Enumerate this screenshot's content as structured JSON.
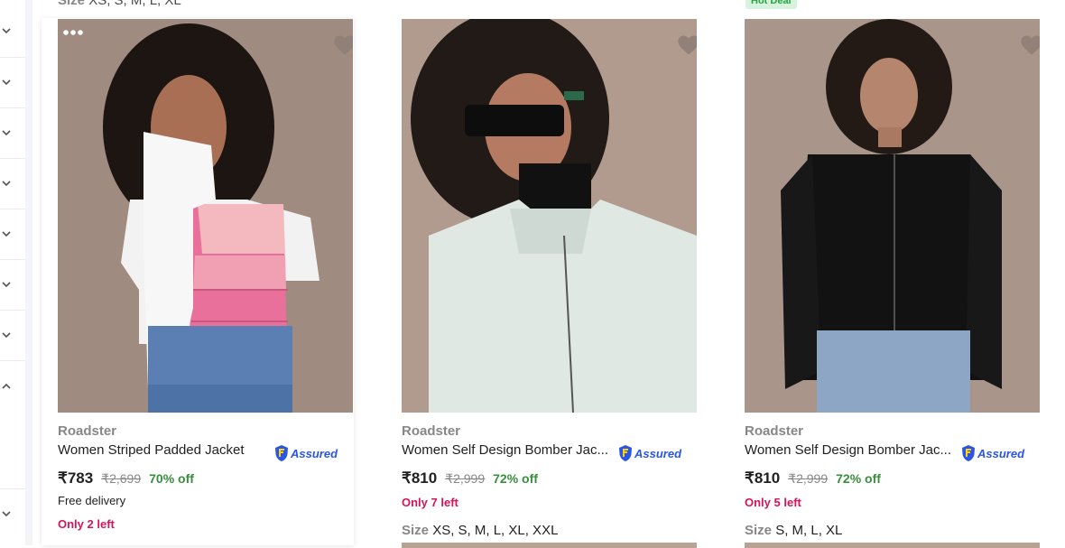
{
  "filters": {
    "chevrons": [
      "down",
      "down",
      "down",
      "down",
      "down",
      "down",
      "down",
      "up",
      "down"
    ]
  },
  "top": {
    "size_label": "Size",
    "size_values": "XS, S, M, L, XL",
    "hot_deal": "Hot Deal"
  },
  "products": [
    {
      "brand": "Roadster",
      "title": "Women Striped Padded Jacket",
      "assured": "Assured",
      "price": "₹783",
      "mrp": "₹2,699",
      "discount": "70% off",
      "delivery": "Free delivery",
      "stock": "Only 2 left",
      "size_label": "",
      "sizes": ""
    },
    {
      "brand": "Roadster",
      "title": "Women Self Design Bomber Jac...",
      "assured": "Assured",
      "price": "₹810",
      "mrp": "₹2,999",
      "discount": "72% off",
      "delivery": "",
      "stock": "Only 7 left",
      "size_label": "Size",
      "sizes": "XS, S, M, L, XL, XXL"
    },
    {
      "brand": "Roadster",
      "title": "Women Self Design Bomber Jac...",
      "assured": "Assured",
      "price": "₹810",
      "mrp": "₹2,999",
      "discount": "72% off",
      "delivery": "",
      "stock": "Only 5 left",
      "size_label": "Size",
      "sizes": "S, M, L, XL"
    }
  ],
  "colors": {
    "accent_green": "#388e3c",
    "stock_red": "#d4145a",
    "assured_blue": "#2a55e5",
    "muted": "#878787"
  },
  "icons": [
    "chevron-down-icon",
    "chevron-up-icon",
    "heart-icon",
    "more-dots-icon",
    "assured-badge-icon"
  ]
}
